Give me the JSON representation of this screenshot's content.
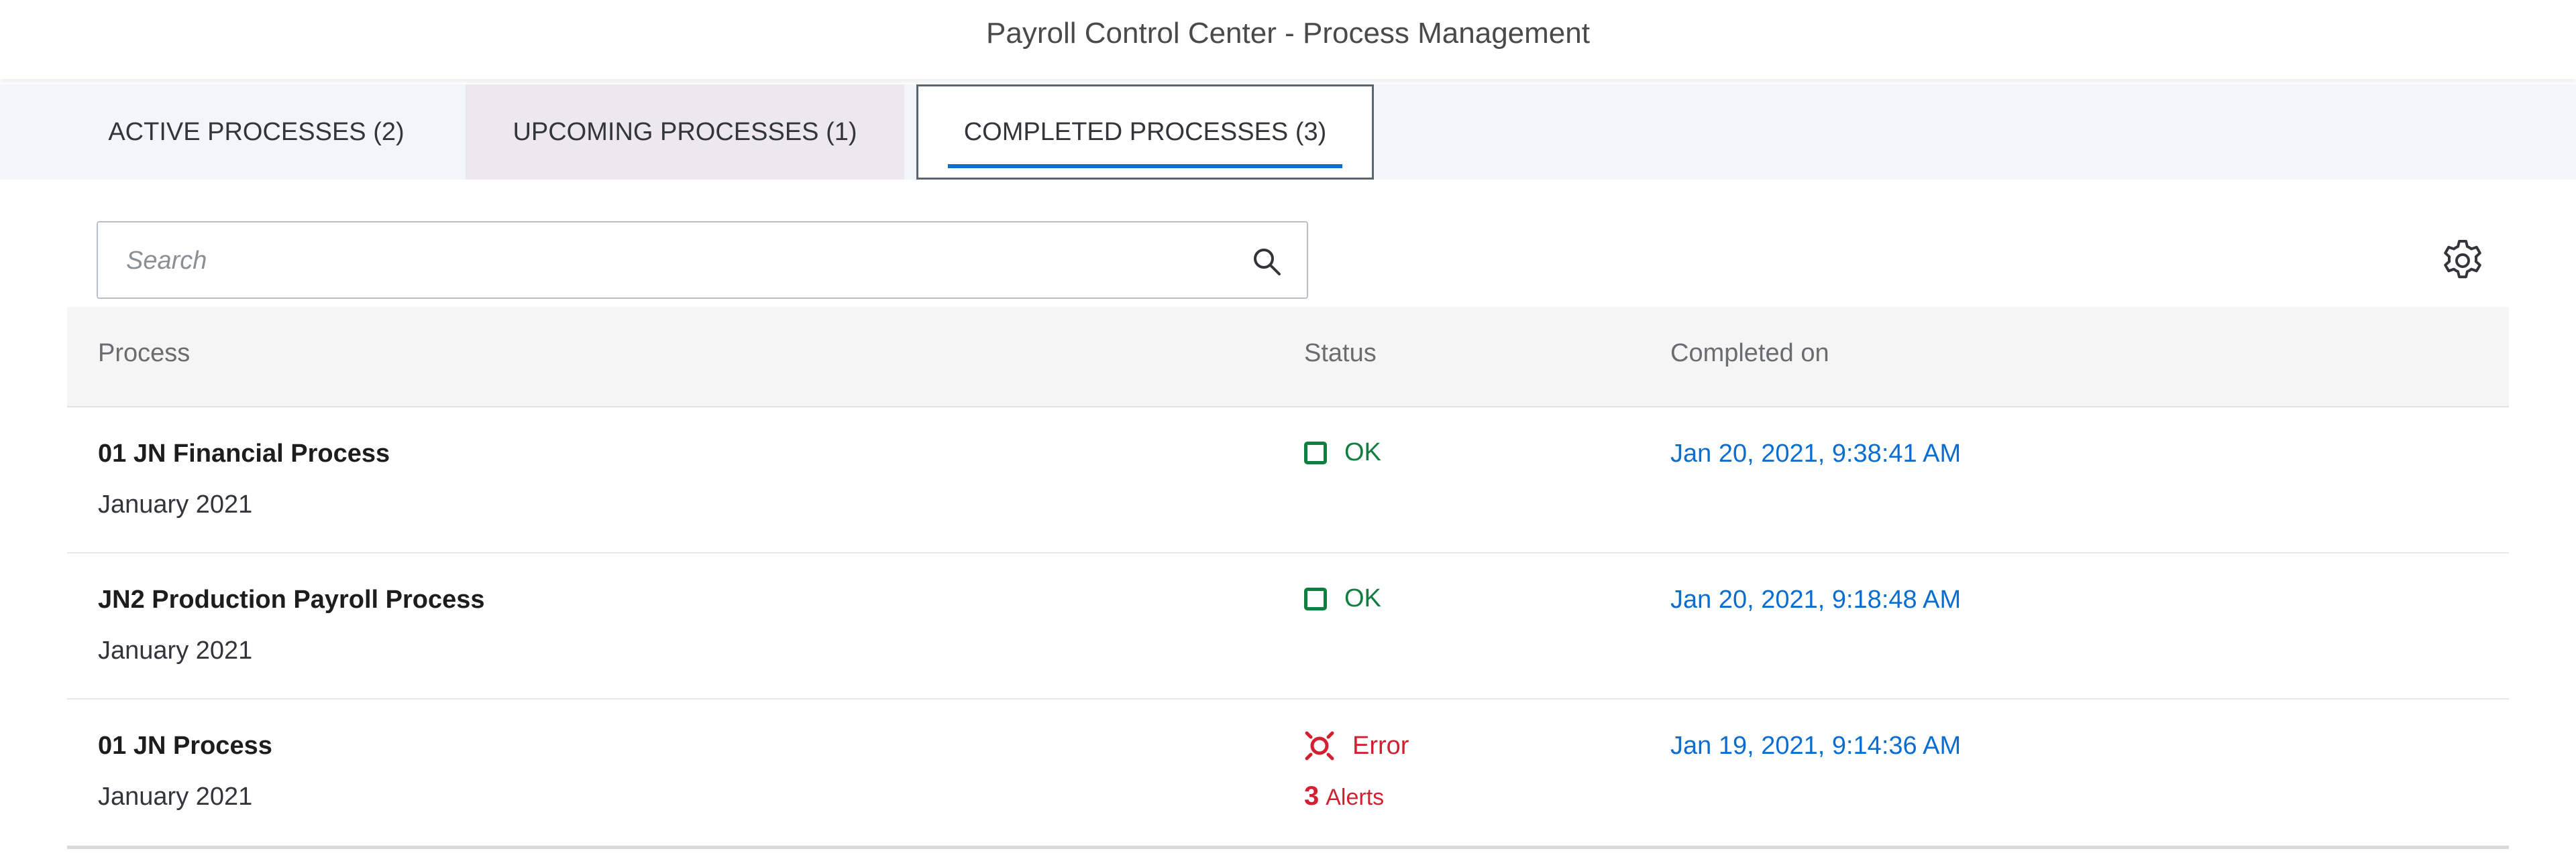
{
  "app": {
    "title": "Payroll Control Center - Process Management"
  },
  "tabs": [
    {
      "label": "ACTIVE PROCESSES (2)",
      "selected": false
    },
    {
      "label": "UPCOMING PROCESSES (1)",
      "selected": false
    },
    {
      "label": "COMPLETED PROCESSES (3)",
      "selected": true
    }
  ],
  "search": {
    "placeholder": "Search",
    "value": ""
  },
  "table": {
    "columns": [
      "Process",
      "Status",
      "Completed on"
    ],
    "rows": [
      {
        "process": "01 JN Financial Process",
        "period": "January 2021",
        "status": "OK",
        "status_icon": "square-check-icon",
        "alerts": null,
        "completed_on": "Jan 20, 2021, 9:38:41 AM"
      },
      {
        "process": "JN2 Production Payroll Process",
        "period": "January 2021",
        "status": "OK",
        "status_icon": "square-check-icon",
        "alerts": null,
        "completed_on": "Jan 20, 2021, 9:18:48 AM"
      },
      {
        "process": "01 JN Process",
        "period": "January 2021",
        "status": "Error",
        "status_icon": "error-target-icon",
        "alerts": {
          "count": "3",
          "label": "Alerts"
        },
        "completed_on": "Jan 19, 2021, 9:14:36 AM"
      }
    ]
  },
  "colors": {
    "accent": "#0a6ed1",
    "ok": "#107e3e",
    "error": "#d32030",
    "tab_bar": "#f2f6fa",
    "header_bg": "#f5f5f5"
  },
  "icons": {
    "search": "search-icon",
    "settings": "gear-icon"
  }
}
